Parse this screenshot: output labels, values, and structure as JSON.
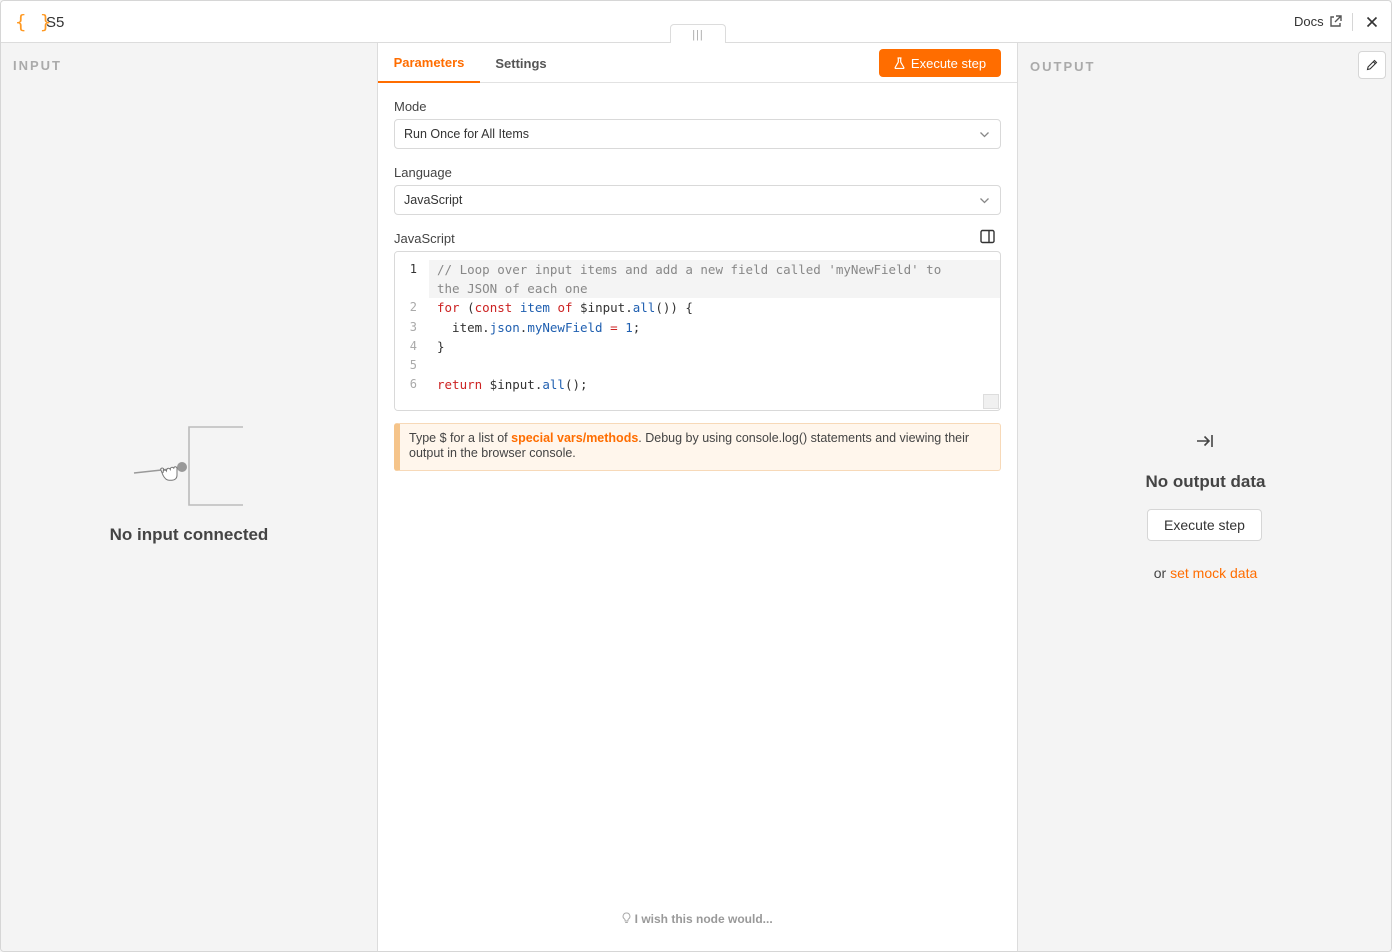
{
  "header": {
    "node_icon": "{ }",
    "title": "S5",
    "drag_handle": "|||",
    "docs_label": "Docs"
  },
  "input_panel": {
    "label": "INPUT",
    "empty_message": "No input connected"
  },
  "tabs": [
    {
      "label": "Parameters",
      "active": true
    },
    {
      "label": "Settings",
      "active": false
    }
  ],
  "toolbar": {
    "execute_label": "Execute step"
  },
  "parameters": {
    "mode_label": "Mode",
    "mode_value": "Run Once for All Items",
    "language_label": "Language",
    "language_value": "JavaScript",
    "code_label": "JavaScript"
  },
  "code": {
    "line_numbers": [
      "1",
      "2",
      "3",
      "4",
      "5",
      "6"
    ],
    "line1a": "// Loop over input items and add a new field called 'myNewField' to",
    "line1b": "the JSON of each one",
    "line2": [
      "for",
      " (",
      "const",
      " ",
      "item",
      " ",
      "of",
      " $input.",
      "all",
      "()) {"
    ],
    "line3": [
      "  item.",
      "json",
      ".",
      "myNewField",
      " ",
      "=",
      " ",
      "1",
      ";"
    ],
    "line4": "}",
    "line6": [
      "return",
      " $input.",
      "all",
      "();"
    ]
  },
  "hint": {
    "prefix": "Type $ for a list of ",
    "link": "special vars/methods",
    "suffix": ". Debug by using console.log() statements and viewing their output in the browser console."
  },
  "feedback": {
    "label": "I wish this node would..."
  },
  "output_panel": {
    "label": "OUTPUT",
    "empty_title": "No output data",
    "execute_label": "Execute step",
    "or_text": "or ",
    "mock_link": "set mock data"
  },
  "colors": {
    "accent": "#ff6d00",
    "node_icon": "#ff9922"
  }
}
